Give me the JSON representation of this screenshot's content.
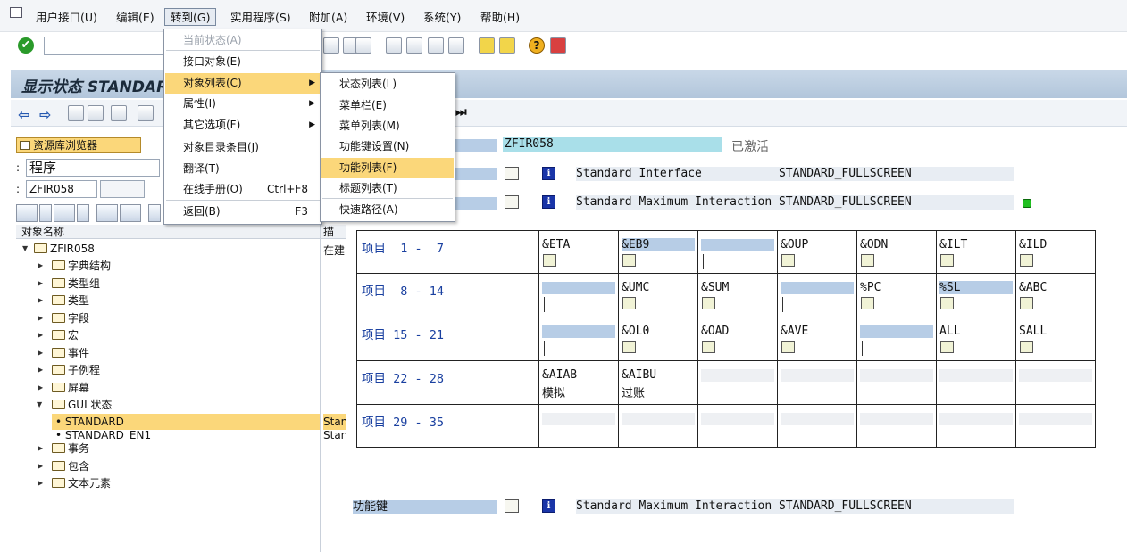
{
  "menubar": {
    "items": [
      "用户接口(U)",
      "编辑(E)",
      "转到(G)",
      "实用程序(S)",
      "附加(A)",
      "环境(V)",
      "系统(Y)",
      "帮助(H)"
    ]
  },
  "title": "显示状态 STANDARD",
  "left": {
    "repo_browser": "资源库浏览器",
    "object_type": "程序",
    "object_name": "ZFIR058",
    "tree_header_col1": "对象名称",
    "tree_header_col2": "描",
    "tree": [
      {
        "label": "ZFIR058",
        "desc": "在建"
      },
      {
        "label": "字典结构"
      },
      {
        "label": "类型组"
      },
      {
        "label": "类型"
      },
      {
        "label": "字段"
      },
      {
        "label": "宏"
      },
      {
        "label": "事件"
      },
      {
        "label": "子例程"
      },
      {
        "label": "屏幕"
      },
      {
        "label": "GUI 状态"
      },
      {
        "label": "STANDARD",
        "desc": "Stan"
      },
      {
        "label": "STANDARD_EN1",
        "desc": "Stan"
      },
      {
        "label": "事务"
      },
      {
        "label": "包含"
      },
      {
        "label": "文本元素"
      }
    ]
  },
  "right": {
    "program_name": "ZFIR058",
    "status": "已激活",
    "interface_line": "Standard Interface           STANDARD_FULLSCREEN",
    "interaction_line": "Standard Maximum Interaction STANDARD_FULLSCREEN",
    "fkeys_label": "功能键",
    "fkeys_line": "Standard Maximum Interaction STANDARD_FULLSCREEN",
    "grid": [
      {
        "label": "项目  1 -  7",
        "cells": [
          {
            "code": "&ETA",
            "icon": "search-icon"
          },
          {
            "code": "&EB9",
            "hl": true,
            "icon": "table-icon"
          },
          {
            "code": "",
            "empty_hl": true,
            "tick": true
          },
          {
            "code": "&OUP",
            "icon": "sort-up-icon"
          },
          {
            "code": "&ODN",
            "icon": "sort-down-icon"
          },
          {
            "code": "&ILT",
            "icon": "filter-icon"
          },
          {
            "code": "&ILD",
            "icon": "filter-delete-icon"
          }
        ]
      },
      {
        "label": "项目  8 - 14",
        "cells": [
          {
            "code": "",
            "empty_hl": true,
            "tick": true
          },
          {
            "code": "&UMC",
            "icon": "sum-icon"
          },
          {
            "code": "&SUM",
            "icon": "subtotal-icon"
          },
          {
            "code": "",
            "empty_hl": true,
            "tick": true
          },
          {
            "code": "%PC",
            "icon": "export-icon"
          },
          {
            "code": "%SL",
            "hl": true,
            "icon": "mail-icon"
          },
          {
            "code": "&ABC",
            "icon": "abc-analysis-icon"
          }
        ]
      },
      {
        "label": "项目 15 - 21",
        "cells": [
          {
            "code": "",
            "empty_hl": true,
            "tick": true
          },
          {
            "code": "&OL0",
            "icon": "layout-icon"
          },
          {
            "code": "&OAD",
            "icon": "choose-layout-icon"
          },
          {
            "code": "&AVE",
            "icon": "save-layout-icon"
          },
          {
            "code": "",
            "empty_hl": true,
            "tick": true
          },
          {
            "code": "ALL",
            "icon": "select-all-icon"
          },
          {
            "code": "SALL",
            "icon": "deselect-all-icon"
          }
        ]
      },
      {
        "label": "项目 22 - 28",
        "cells": [
          {
            "code": "&AIAB",
            "text2": "模拟"
          },
          {
            "code": "&AIBU",
            "text2": "过账"
          },
          {
            "code": "",
            "empty": true
          },
          {
            "code": "",
            "empty": true
          },
          {
            "code": "",
            "empty": true
          },
          {
            "code": "",
            "empty": true
          },
          {
            "code": "",
            "empty": true
          }
        ]
      },
      {
        "label": "项目 29 - 35",
        "cells": [
          {
            "code": "",
            "empty": true
          },
          {
            "code": "",
            "empty": true
          },
          {
            "code": "",
            "empty": true
          },
          {
            "code": "",
            "empty": true
          },
          {
            "code": "",
            "empty": true
          },
          {
            "code": "",
            "empty": true
          },
          {
            "code": "",
            "empty": true
          }
        ]
      }
    ]
  },
  "goto_menu": {
    "items": [
      {
        "label": "当前状态(A)",
        "disabled": true
      },
      {
        "label": "接口对象(E)"
      },
      {
        "label": "对象列表(C)",
        "submenu": true,
        "highlight": true
      },
      {
        "label": "属性(I)",
        "submenu": true
      },
      {
        "label": "其它选项(F)",
        "submenu": true
      },
      {
        "label": "对象目录条目(J)"
      },
      {
        "label": "翻译(T)"
      },
      {
        "label": "在线手册(O)",
        "shortcut": "Ctrl+F8"
      },
      {
        "label": "返回(B)",
        "shortcut": "F3"
      }
    ]
  },
  "object_list_menu": {
    "items": [
      {
        "label": "状态列表(L)"
      },
      {
        "label": "菜单栏(E)"
      },
      {
        "label": "菜单列表(M)"
      },
      {
        "label": "功能键设置(N)"
      },
      {
        "label": "功能列表(F)",
        "highlight": true
      },
      {
        "label": "标题列表(T)"
      },
      {
        "label": "快速路径(A)"
      }
    ]
  }
}
